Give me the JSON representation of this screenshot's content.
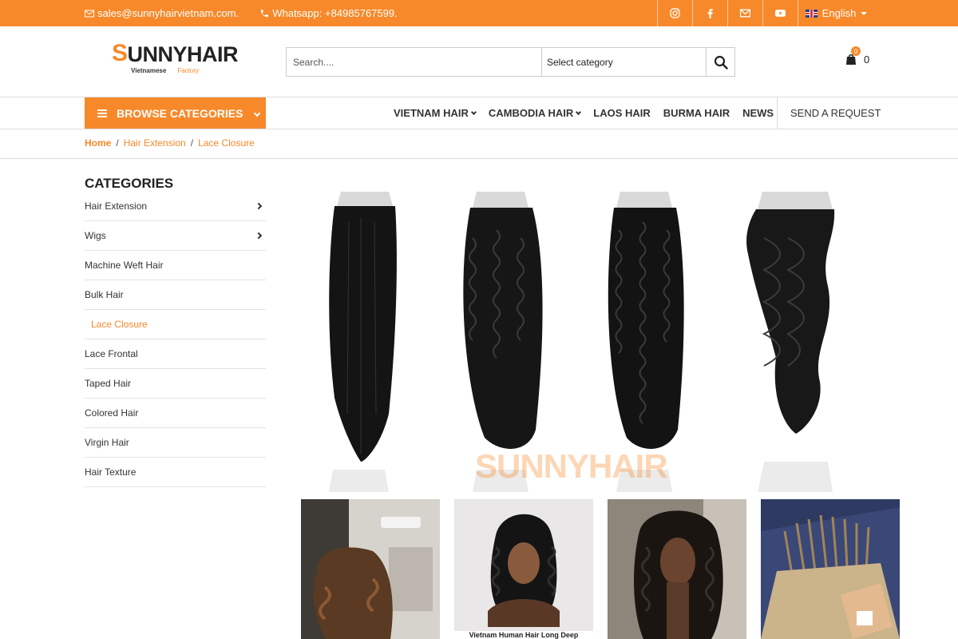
{
  "topbar": {
    "email": "sales@sunnyhairvietnam.com.",
    "whatsapp": "Whatsapp: +84985767599.",
    "language": "English"
  },
  "logo": {
    "brand_s": "S",
    "brand_u": "U",
    "brand_nny": "NNY",
    "brand_hair_h": "H",
    "brand_hair_rest": "AIR",
    "tag_left": "Vietnamese",
    "tag_right": "Factory"
  },
  "search": {
    "placeholder": "Search....",
    "category_label": "Select category"
  },
  "cart": {
    "count": "0",
    "badge": "0"
  },
  "nav": {
    "browse_label": "BROWSE CATEGORIES",
    "items": [
      "VIETNAM HAIR",
      "CAMBODIA HAIR",
      "LAOS HAIR",
      "BURMA HAIR",
      "NEWS"
    ],
    "request": "SEND A REQUEST"
  },
  "breadcrumb": {
    "home": "Home",
    "level1": "Hair Extension",
    "level2": "Lace Closure",
    "separator": "/"
  },
  "sidebar": {
    "title": "CATEGORIES",
    "items": [
      {
        "label": "Hair Extension"
      },
      {
        "label": "Wigs"
      },
      {
        "label": "Machine Weft Hair"
      },
      {
        "label": "Bulk Hair"
      },
      {
        "label": "Lace Closure"
      },
      {
        "label": "Lace Frontal"
      },
      {
        "label": "Taped Hair"
      },
      {
        "label": "Colored Hair"
      },
      {
        "label": "Virgin Hair"
      },
      {
        "label": "Hair Texture"
      }
    ]
  },
  "hero": {
    "watermark": "SUNNYHAIR"
  },
  "thumbs": {
    "caption_2": "Vietnam Human Hair Long Deep"
  },
  "colors": {
    "accent": "#f7892a",
    "text": "#222222",
    "border": "#dddddd"
  }
}
